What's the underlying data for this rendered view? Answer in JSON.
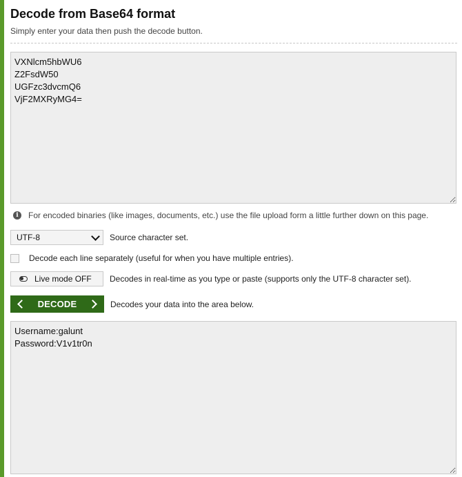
{
  "header": {
    "title": "Decode from Base64 format",
    "subtitle": "Simply enter your data then push the decode button."
  },
  "input": {
    "value": "VXNlcm5hbWU6\nZ2FsdW50\nUGFzc3dvcmQ6\nVjF2MXRyMG4="
  },
  "info": {
    "icon": "info-icon",
    "text": "For encoded binaries (like images, documents, etc.) use the file upload form a little further down on this page."
  },
  "charset": {
    "selected": "UTF-8",
    "label": "Source character set."
  },
  "line_option": {
    "label": "Decode each line separately (useful for when you have multiple entries)."
  },
  "live_mode": {
    "button_label": "Live mode OFF",
    "description": "Decodes in real-time as you type or paste (supports only the UTF-8 character set)."
  },
  "decode": {
    "button_label": "DECODE",
    "description": "Decodes your data into the area below."
  },
  "output": {
    "value": "Username:galunt\nPassword:V1v1tr0n"
  },
  "colors": {
    "accent_green": "#2f6a18",
    "frame_green": "#5a9a2a",
    "field_bg": "#eeeeee"
  }
}
